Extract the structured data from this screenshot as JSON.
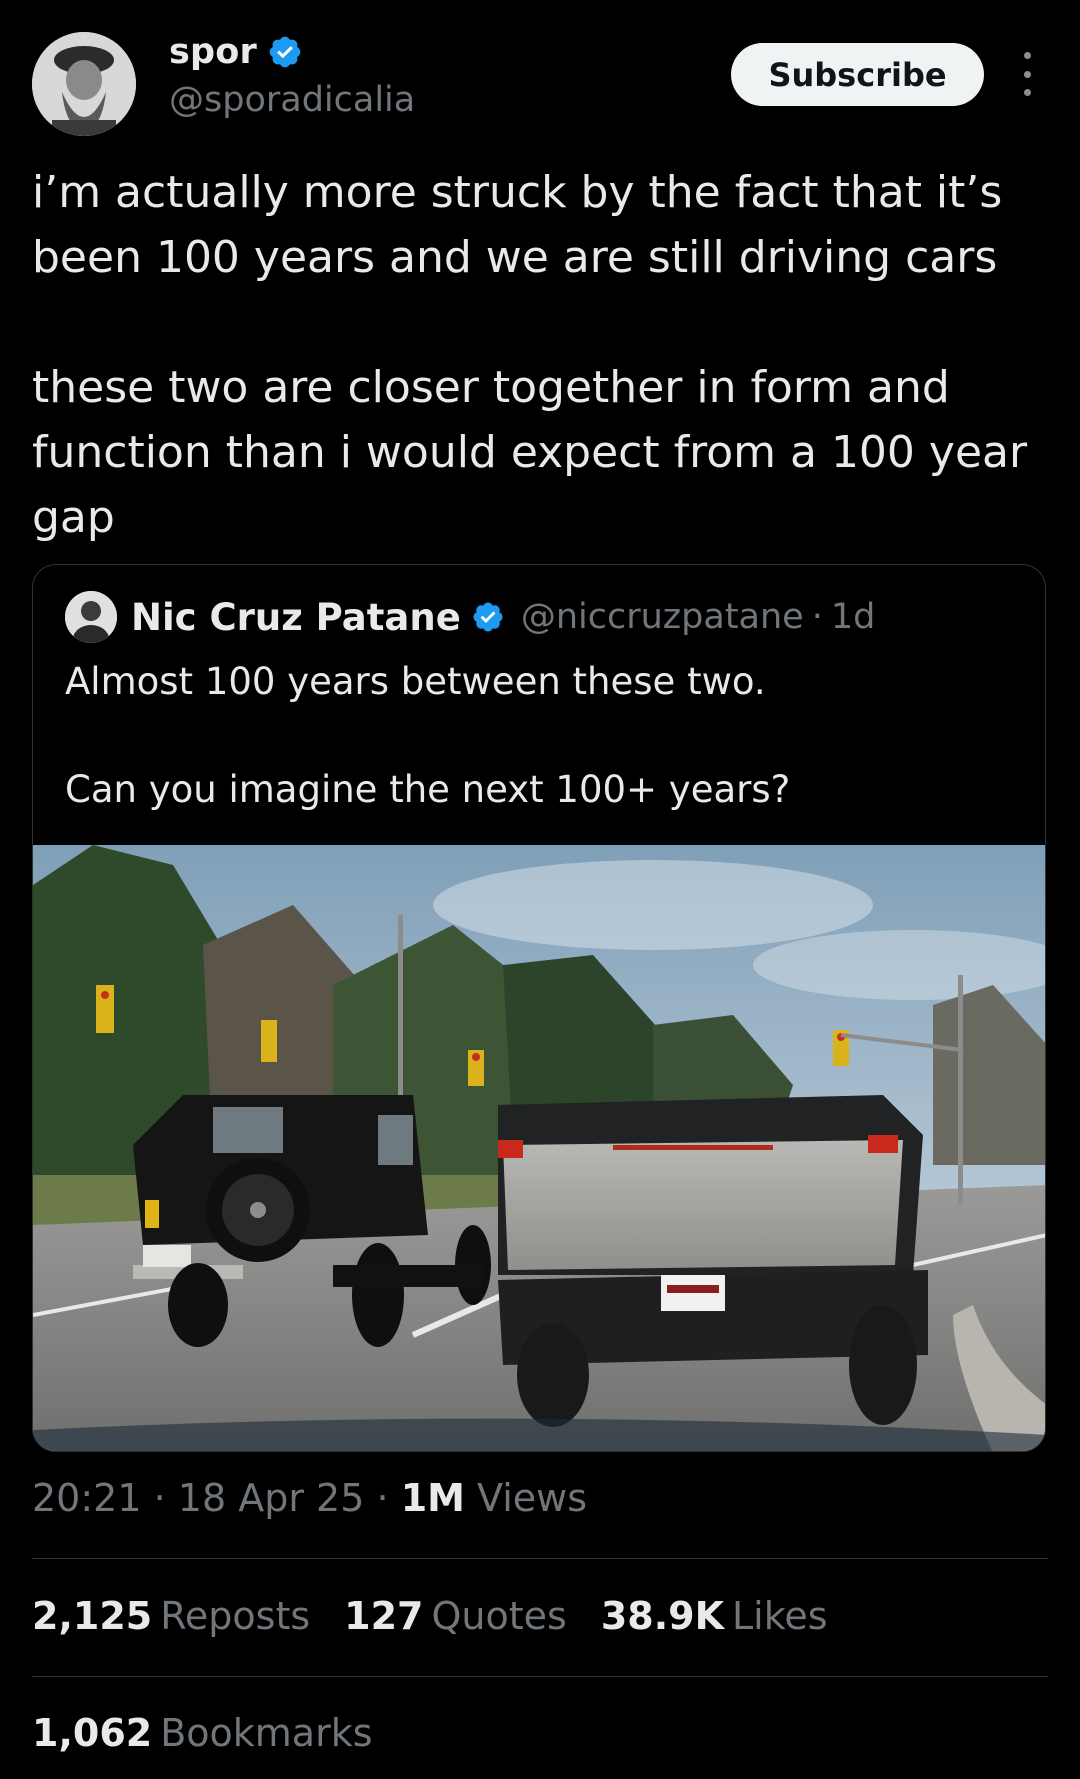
{
  "author": {
    "display_name": "spor",
    "handle": "@sporadicalia",
    "verified_color": "#1d9bf0"
  },
  "subscribe_label": "Subscribe",
  "more_icon": "more-vertical-icon",
  "tweet_text": "i’m actually more struck by the fact that it’s been 100 years and we are still driving cars\n\nthese two are closer together in form and function than i would expect from a 100 year gap",
  "quote": {
    "display_name": "Nic Cruz Patane",
    "handle": "@niccruzpatane",
    "separator": "·",
    "time": "1d",
    "text": "Almost 100 years between these two.\n\nCan you imagine the next 100+ years?",
    "photo": "photo-vintage-car-and-cybertruck"
  },
  "meta": {
    "time": "20:21",
    "sep1": "·",
    "date": "18 Apr 25",
    "sep2": "·",
    "views_count": "1M",
    "views_label": "Views"
  },
  "stats": {
    "reposts_count": "2,125",
    "reposts_label": "Reposts",
    "quotes_count": "127",
    "quotes_label": "Quotes",
    "likes_count": "38.9K",
    "likes_label": "Likes",
    "bookmarks_count": "1,062",
    "bookmarks_label": "Bookmarks"
  },
  "colors": {
    "background": "#000000",
    "text": "#e7e9ea",
    "muted": "#71767b",
    "border": "#2f3336",
    "accent": "#1d9bf0"
  }
}
